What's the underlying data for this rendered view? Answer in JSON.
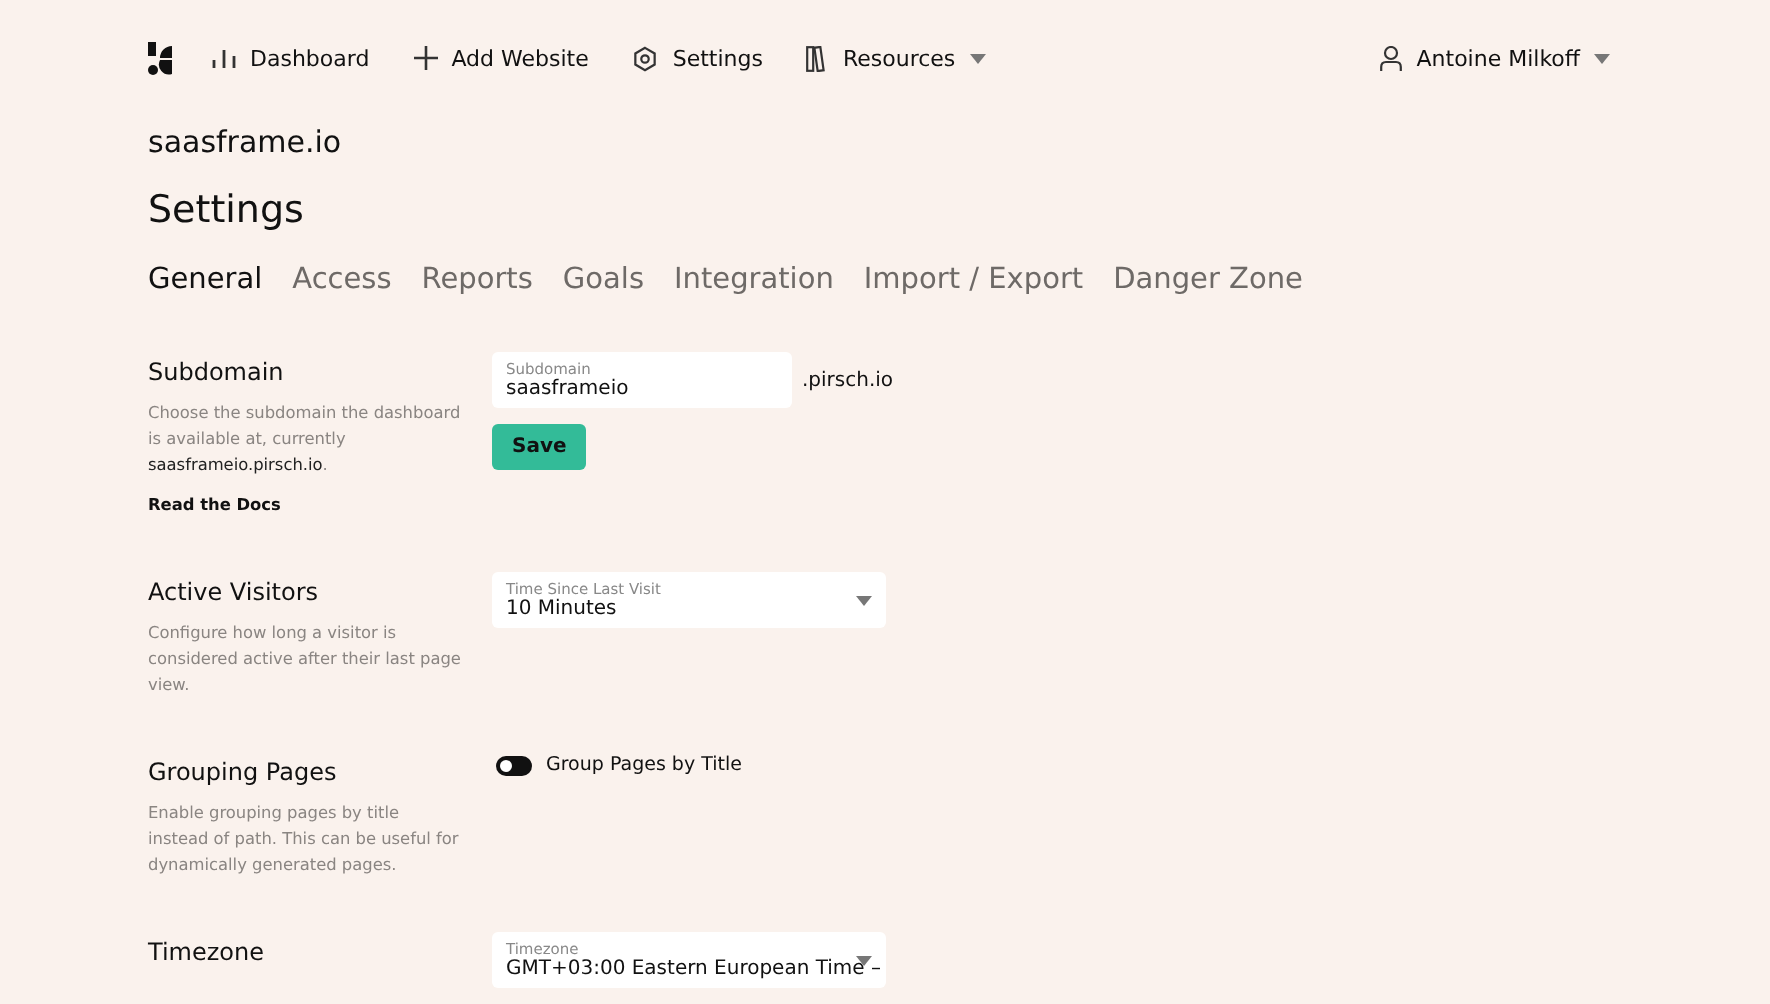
{
  "nav": {
    "items": [
      {
        "label": "Dashboard",
        "dropdown": false
      },
      {
        "label": "Add Website",
        "dropdown": false
      },
      {
        "label": "Settings",
        "dropdown": false
      },
      {
        "label": "Resources",
        "dropdown": true
      }
    ],
    "user": {
      "name": "Antoine Milkoff"
    }
  },
  "site": "saasframe.io",
  "title": "Settings",
  "tabs": [
    {
      "label": "General",
      "selected": true
    },
    {
      "label": "Access",
      "selected": false
    },
    {
      "label": "Reports",
      "selected": false
    },
    {
      "label": "Goals",
      "selected": false
    },
    {
      "label": "Integration",
      "selected": false
    },
    {
      "label": "Import / Export",
      "selected": false
    },
    {
      "label": "Danger Zone",
      "selected": false
    }
  ],
  "sections": [
    {
      "title": "Subdomain",
      "description": "Choose the subdomain the dashboard is available at, currently **saasframeio.pirsch.io**.",
      "link": "Read the Docs",
      "control": {
        "kind": "text-field",
        "label": "Subdomain",
        "value": "saasframeio",
        "suffix": ".pirsch.io",
        "button": "Save"
      }
    },
    {
      "title": "Active Visitors",
      "description": "Configure how long a visitor is considered active after their last page view.",
      "control": {
        "kind": "select",
        "label": "Time Since Last Visit",
        "value": "10 Minutes"
      }
    },
    {
      "title": "Grouping Pages",
      "description": "Enable grouping pages by title instead of path. This can be useful for dynamically generated pages.",
      "control": {
        "kind": "toggle",
        "label": "Group Pages by Title",
        "on": false
      }
    },
    {
      "title": "Timezone",
      "control": {
        "kind": "select",
        "label": "Timezone",
        "value": "GMT+03:00 Eastern European Time –"
      }
    }
  ]
}
